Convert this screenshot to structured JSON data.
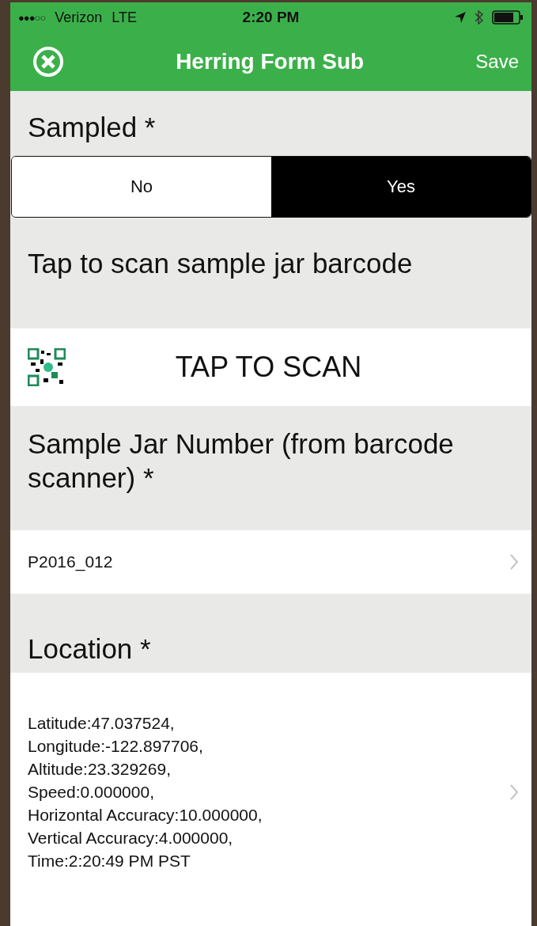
{
  "status_bar": {
    "signal_dots": "●●●○○",
    "carrier": "Verizon",
    "network": "LTE",
    "time": "2:20 PM"
  },
  "nav_bar": {
    "title": "Herring Form Sub",
    "save": "Save"
  },
  "fields": [
    {
      "kind": "segmented",
      "label": "Sampled *",
      "options": [
        {
          "label": "No",
          "selected": false
        },
        {
          "label": "Yes",
          "selected": true
        }
      ]
    },
    {
      "kind": "scan",
      "label": "Tap to scan sample jar barcode",
      "button": "TAP TO SCAN"
    },
    {
      "kind": "value",
      "label": "Sample Jar Number (from barcode scanner) *",
      "value": "P2016_012"
    },
    {
      "kind": "location",
      "label": "Location *",
      "lines": [
        "Latitude:47.037524,",
        "Longitude:-122.897706,",
        "Altitude:23.329269,",
        "Speed:0.000000,",
        "Horizontal Accuracy:10.000000,",
        "Vertical Accuracy:4.000000,",
        "Time:2:20:49 PM PST"
      ]
    }
  ]
}
